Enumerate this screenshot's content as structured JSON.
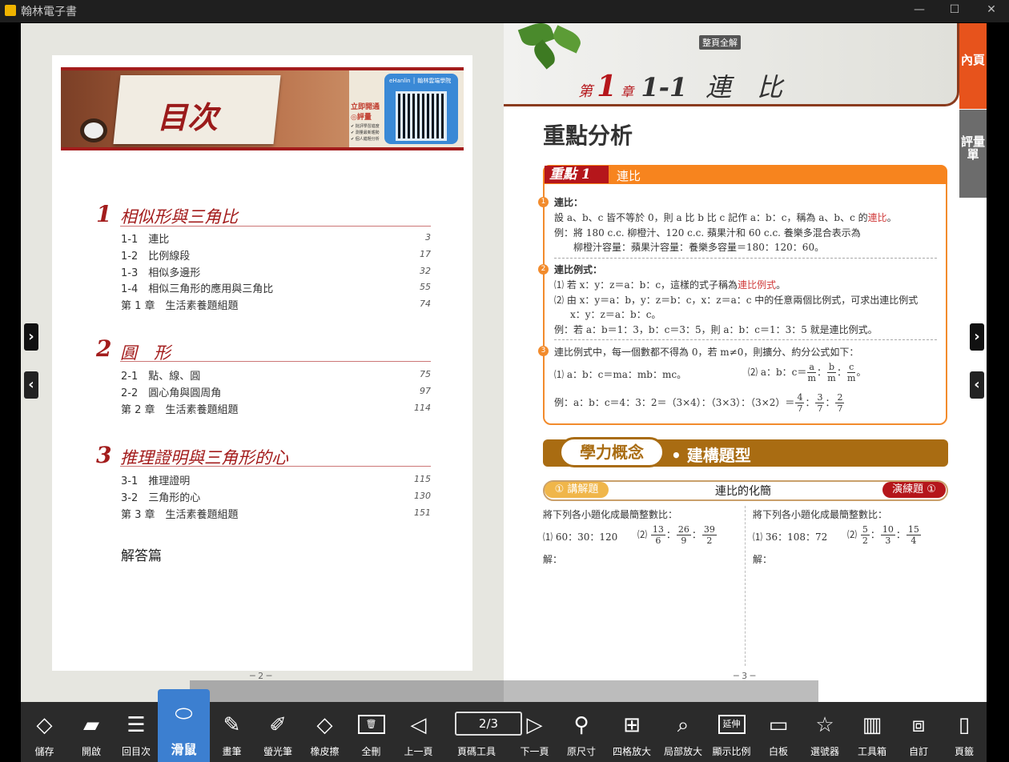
{
  "window": {
    "title": "翰林電子書",
    "minimize": "—",
    "maximize": "☐",
    "close": "✕"
  },
  "left_page": {
    "banner_title": "目次",
    "qr": {
      "brand": "eHanlin │ 翰林雲端學院",
      "side1": "立即開通",
      "side2": "◎評量",
      "list": [
        "✔ 批評學習進度",
        "✔ 測量最新趨勢",
        "✔ 個人錯題分析"
      ]
    },
    "chapters": [
      {
        "num": "1",
        "title": "相似形與三角比",
        "items": [
          {
            "label": "1-1　連比",
            "page": "3"
          },
          {
            "label": "1-2　比例線段",
            "page": "17"
          },
          {
            "label": "1-3　相似多邊形",
            "page": "32"
          },
          {
            "label": "1-4　相似三角形的應用與三角比",
            "page": "55"
          },
          {
            "label": "第 1 章　生活素養題組題",
            "page": "74"
          }
        ]
      },
      {
        "num": "2",
        "title": "圓　形",
        "items": [
          {
            "label": "2-1　點、線、圓",
            "page": "75"
          },
          {
            "label": "2-2　圓心角與圓周角",
            "page": "97"
          },
          {
            "label": "第 2 章　生活素養題組題",
            "page": "114"
          }
        ]
      },
      {
        "num": "3",
        "title": "推理證明與三角形的心",
        "items": [
          {
            "label": "3-1　推理證明",
            "page": "115"
          },
          {
            "label": "3-2　三角形的心",
            "page": "130"
          },
          {
            "label": "第 3 章　生活素養題組題",
            "page": "151"
          }
        ]
      }
    ],
    "answer_section": "解答篇",
    "page_number": "─ 2 ─"
  },
  "right_page": {
    "badge": "整頁全解",
    "chapter_prefix": "第",
    "chapter_num": "1",
    "chapter_suffix": "章",
    "section_code": "1-1",
    "section_name": "連　比",
    "analysis_title": "重點分析",
    "key_tag": "重點 1",
    "key_name": "連比",
    "p1_title": "連比：",
    "p1_line1": "設 a、b、c 皆不等於 0，則 a 比 b 比 c 記作 a：b：c，稱為 a、b、c 的",
    "p1_red": "連比",
    "p1_end": "。",
    "p1_ex1": "例：將 180 c.c. 柳橙汁、120 c.c. 蘋果汁和 60 c.c. 養樂多混合表示為",
    "p1_ex2": "柳橙汁容量：蘋果汁容量：養樂多容量＝180：120：60。",
    "p2_title": "連比例式：",
    "p2_line1": "⑴ 若 x：y：z＝a：b：c，這樣的式子稱為",
    "p2_red": "連比例式",
    "p2_line2": "⑵ 由 x：y＝a：b，y：z＝b：c，x：z＝a：c 中的任意兩個比例式，可求出連比例式",
    "p2_line3": "x：y：z＝a：b：c。",
    "p2_ex": "例：若 a：b＝1：3，b：c＝3：5，則 a：b：c＝1：3：5 就是連比例式。",
    "p3_line": "連比例式中，每一個數都不得為 0，若 m≠0，則擴分、約分公式如下：",
    "p3_f1": "⑴ a：b：c＝ma：mb：mc。",
    "p3_f2": "⑵ a：b：c＝",
    "p3_ex": "例：a：b：c＝4：3：2＝（3×4）：（3×3）：（3×2）＝",
    "concept_pill": "學力概念",
    "concept_sub": "• 建構題型",
    "ex_left": "① 講解題",
    "ex_title": "連比的化簡",
    "ex_right": "演練題 ①",
    "q_left": "將下列各小題化成最簡整數比：",
    "q_left_1": "⑴ 60：30：120",
    "q_left_2": "⑵",
    "q_left_fracs": [
      [
        "13",
        "6"
      ],
      [
        "26",
        "9"
      ],
      [
        "39",
        "2"
      ]
    ],
    "q_right": "將下列各小題化成最簡整數比：",
    "q_right_1": "⑴ 36：108：72",
    "q_right_2": "⑵",
    "q_right_fracs": [
      [
        "5",
        "2"
      ],
      [
        "10",
        "3"
      ],
      [
        "15",
        "4"
      ]
    ],
    "ans_label": "解：",
    "page_number": "─ 3 ─"
  },
  "side_tabs": {
    "neiye": "內頁",
    "pingliang": "評量單"
  },
  "nav": {
    "next": "›",
    "prev": "‹"
  },
  "toolbar": [
    {
      "label": "儲存",
      "icon": "◇"
    },
    {
      "label": "開啟",
      "icon": "▰"
    },
    {
      "label": "回目次",
      "icon": "☰"
    },
    {
      "label": "滑鼠",
      "icon": "⬭",
      "active": true
    },
    {
      "label": "畫筆",
      "icon": "✎"
    },
    {
      "label": "螢光筆",
      "icon": "✐"
    },
    {
      "label": "橡皮擦",
      "icon": "◇"
    },
    {
      "label": "全刪",
      "icon": "🗑"
    },
    {
      "label": "上一頁",
      "icon": "◁"
    },
    {
      "label": "頁碼工具",
      "icon": "2/3"
    },
    {
      "label": "下一頁",
      "icon": "▷"
    },
    {
      "label": "原尺寸",
      "icon": "⚲"
    },
    {
      "label": "四格放大",
      "icon": "⊞"
    },
    {
      "label": "局部放大",
      "icon": "⌕"
    },
    {
      "label": "顯示比例",
      "icon": "延伸"
    },
    {
      "label": "白板",
      "icon": "▭"
    },
    {
      "label": "選號器",
      "icon": "☆"
    },
    {
      "label": "工具箱",
      "icon": "▥"
    },
    {
      "label": "自訂",
      "icon": "⧈"
    },
    {
      "label": "頁籤",
      "icon": "▯"
    }
  ],
  "colors": {
    "accent_orange": "#f7841e",
    "brand_red": "#a31c1c",
    "active_tool": "#3c7fd0"
  }
}
